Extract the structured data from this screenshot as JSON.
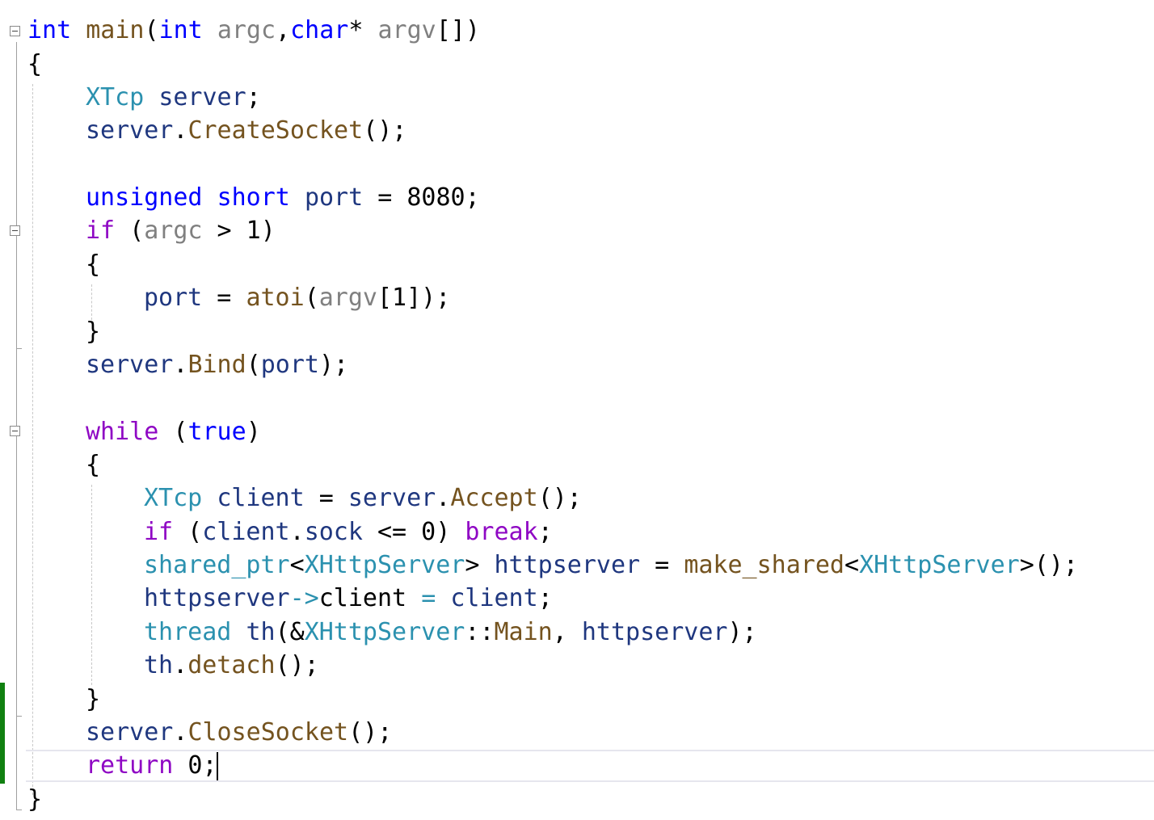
{
  "editor": {
    "language": "C++",
    "has_unsaved_changes_marker": true,
    "current_line_index": 22,
    "lines": [
      [
        {
          "c": "kw",
          "t": "int"
        },
        {
          "c": "pl",
          "t": " "
        },
        {
          "c": "fn",
          "t": "main"
        },
        {
          "c": "pl",
          "t": "("
        },
        {
          "c": "kw",
          "t": "int"
        },
        {
          "c": "pl",
          "t": " "
        },
        {
          "c": "pm",
          "t": "argc"
        },
        {
          "c": "pl",
          "t": ","
        },
        {
          "c": "kw",
          "t": "char"
        },
        {
          "c": "pl",
          "t": "* "
        },
        {
          "c": "pm",
          "t": "argv"
        },
        {
          "c": "pl",
          "t": "[])"
        }
      ],
      [
        {
          "c": "pl",
          "t": "{"
        }
      ],
      [
        {
          "c": "ty",
          "t": "XTcp"
        },
        {
          "c": "pl",
          "t": " "
        },
        {
          "c": "loc",
          "t": "server"
        },
        {
          "c": "pl",
          "t": ";"
        }
      ],
      [
        {
          "c": "loc",
          "t": "server"
        },
        {
          "c": "pl",
          "t": "."
        },
        {
          "c": "fn",
          "t": "CreateSocket"
        },
        {
          "c": "pl",
          "t": "();"
        }
      ],
      [],
      [
        {
          "c": "kw",
          "t": "unsigned"
        },
        {
          "c": "pl",
          "t": " "
        },
        {
          "c": "kw",
          "t": "short"
        },
        {
          "c": "pl",
          "t": " "
        },
        {
          "c": "loc",
          "t": "port"
        },
        {
          "c": "pl",
          "t": " = 8080;"
        }
      ],
      [
        {
          "c": "ctl",
          "t": "if"
        },
        {
          "c": "pl",
          "t": " ("
        },
        {
          "c": "pm",
          "t": "argc"
        },
        {
          "c": "pl",
          "t": " > 1)"
        }
      ],
      [
        {
          "c": "pl",
          "t": "{"
        }
      ],
      [
        {
          "c": "loc",
          "t": "port"
        },
        {
          "c": "pl",
          "t": " = "
        },
        {
          "c": "fn",
          "t": "atoi"
        },
        {
          "c": "pl",
          "t": "("
        },
        {
          "c": "pm",
          "t": "argv"
        },
        {
          "c": "pl",
          "t": "[1]);"
        }
      ],
      [
        {
          "c": "pl",
          "t": "}"
        }
      ],
      [
        {
          "c": "loc",
          "t": "server"
        },
        {
          "c": "pl",
          "t": "."
        },
        {
          "c": "fn",
          "t": "Bind"
        },
        {
          "c": "pl",
          "t": "("
        },
        {
          "c": "loc",
          "t": "port"
        },
        {
          "c": "pl",
          "t": ");"
        }
      ],
      [],
      [
        {
          "c": "ctl",
          "t": "while"
        },
        {
          "c": "pl",
          "t": " ("
        },
        {
          "c": "kw",
          "t": "true"
        },
        {
          "c": "pl",
          "t": ")"
        }
      ],
      [
        {
          "c": "pl",
          "t": "{"
        }
      ],
      [
        {
          "c": "ty",
          "t": "XTcp"
        },
        {
          "c": "pl",
          "t": " "
        },
        {
          "c": "loc",
          "t": "client"
        },
        {
          "c": "pl",
          "t": " = "
        },
        {
          "c": "loc",
          "t": "server"
        },
        {
          "c": "pl",
          "t": "."
        },
        {
          "c": "fn",
          "t": "Accept"
        },
        {
          "c": "pl",
          "t": "();"
        }
      ],
      [
        {
          "c": "ctl",
          "t": "if"
        },
        {
          "c": "pl",
          "t": " ("
        },
        {
          "c": "loc",
          "t": "client"
        },
        {
          "c": "pl",
          "t": "."
        },
        {
          "c": "loc",
          "t": "sock"
        },
        {
          "c": "pl",
          "t": " <= 0) "
        },
        {
          "c": "ctl",
          "t": "break"
        },
        {
          "c": "pl",
          "t": ";"
        }
      ],
      [
        {
          "c": "ty",
          "t": "shared_ptr"
        },
        {
          "c": "pl",
          "t": "<"
        },
        {
          "c": "ty",
          "t": "XHttpServer"
        },
        {
          "c": "pl",
          "t": "> "
        },
        {
          "c": "loc",
          "t": "httpserver"
        },
        {
          "c": "pl",
          "t": " = "
        },
        {
          "c": "fn",
          "t": "make_shared"
        },
        {
          "c": "pl",
          "t": "<"
        },
        {
          "c": "ty",
          "t": "XHttpServer"
        },
        {
          "c": "pl",
          "t": ">();"
        }
      ],
      [
        {
          "c": "loc",
          "t": "httpserver"
        },
        {
          "c": "ty",
          "t": "->"
        },
        {
          "c": "pl",
          "t": "client "
        },
        {
          "c": "ty",
          "t": "="
        },
        {
          "c": "pl",
          "t": " "
        },
        {
          "c": "loc",
          "t": "client"
        },
        {
          "c": "pl",
          "t": ";"
        }
      ],
      [
        {
          "c": "ty",
          "t": "thread"
        },
        {
          "c": "pl",
          "t": " "
        },
        {
          "c": "loc",
          "t": "th"
        },
        {
          "c": "pl",
          "t": "(&"
        },
        {
          "c": "ty",
          "t": "XHttpServer"
        },
        {
          "c": "pl",
          "t": "::"
        },
        {
          "c": "fn",
          "t": "Main"
        },
        {
          "c": "pl",
          "t": ", "
        },
        {
          "c": "loc",
          "t": "httpserver"
        },
        {
          "c": "pl",
          "t": ");"
        }
      ],
      [
        {
          "c": "loc",
          "t": "th"
        },
        {
          "c": "pl",
          "t": "."
        },
        {
          "c": "fn",
          "t": "detach"
        },
        {
          "c": "pl",
          "t": "();"
        }
      ],
      [
        {
          "c": "pl",
          "t": "}"
        }
      ],
      [
        {
          "c": "loc",
          "t": "server"
        },
        {
          "c": "pl",
          "t": "."
        },
        {
          "c": "fn",
          "t": "CloseSocket"
        },
        {
          "c": "pl",
          "t": "();"
        }
      ],
      [
        {
          "c": "ctl",
          "t": "return"
        },
        {
          "c": "pl",
          "t": " 0;"
        }
      ],
      [
        {
          "c": "pl",
          "t": "}"
        }
      ]
    ]
  }
}
